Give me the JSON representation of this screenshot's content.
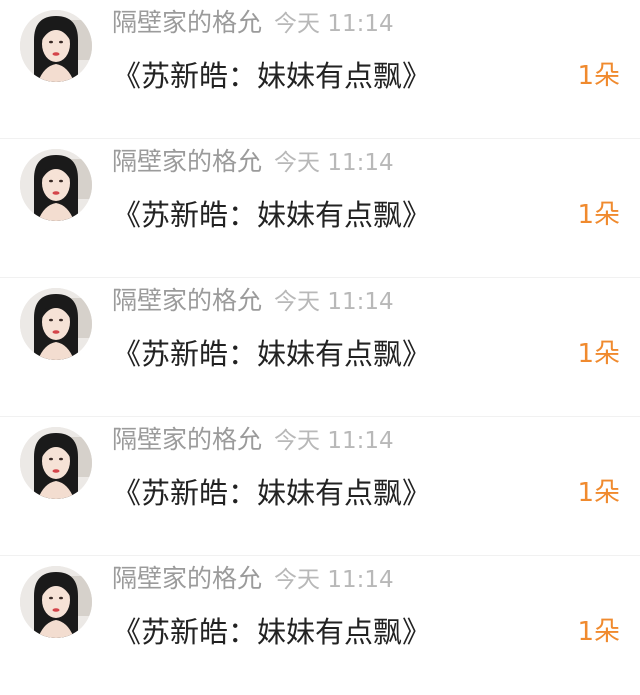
{
  "conversation_list": {
    "items": [
      {
        "sender": "隔壁家的格允",
        "time": "今天 11:14",
        "message": "《苏新皓：妹妹有点飘》",
        "count": "1朵"
      },
      {
        "sender": "隔壁家的格允",
        "time": "今天 11:14",
        "message": "《苏新皓：妹妹有点飘》",
        "count": "1朵"
      },
      {
        "sender": "隔壁家的格允",
        "time": "今天 11:14",
        "message": "《苏新皓：妹妹有点飘》",
        "count": "1朵"
      },
      {
        "sender": "隔壁家的格允",
        "time": "今天 11:14",
        "message": "《苏新皓：妹妹有点飘》",
        "count": "1朵"
      },
      {
        "sender": "隔壁家的格允",
        "time": "今天 11:14",
        "message": "《苏新皓：妹妹有点飘》",
        "count": "1朵"
      }
    ]
  },
  "colors": {
    "sender_text": "#9b9b9b",
    "time_text": "#b8b8b8",
    "message_text": "#222222",
    "count_accent": "#f08a2e",
    "divider": "#f1f1f1"
  }
}
